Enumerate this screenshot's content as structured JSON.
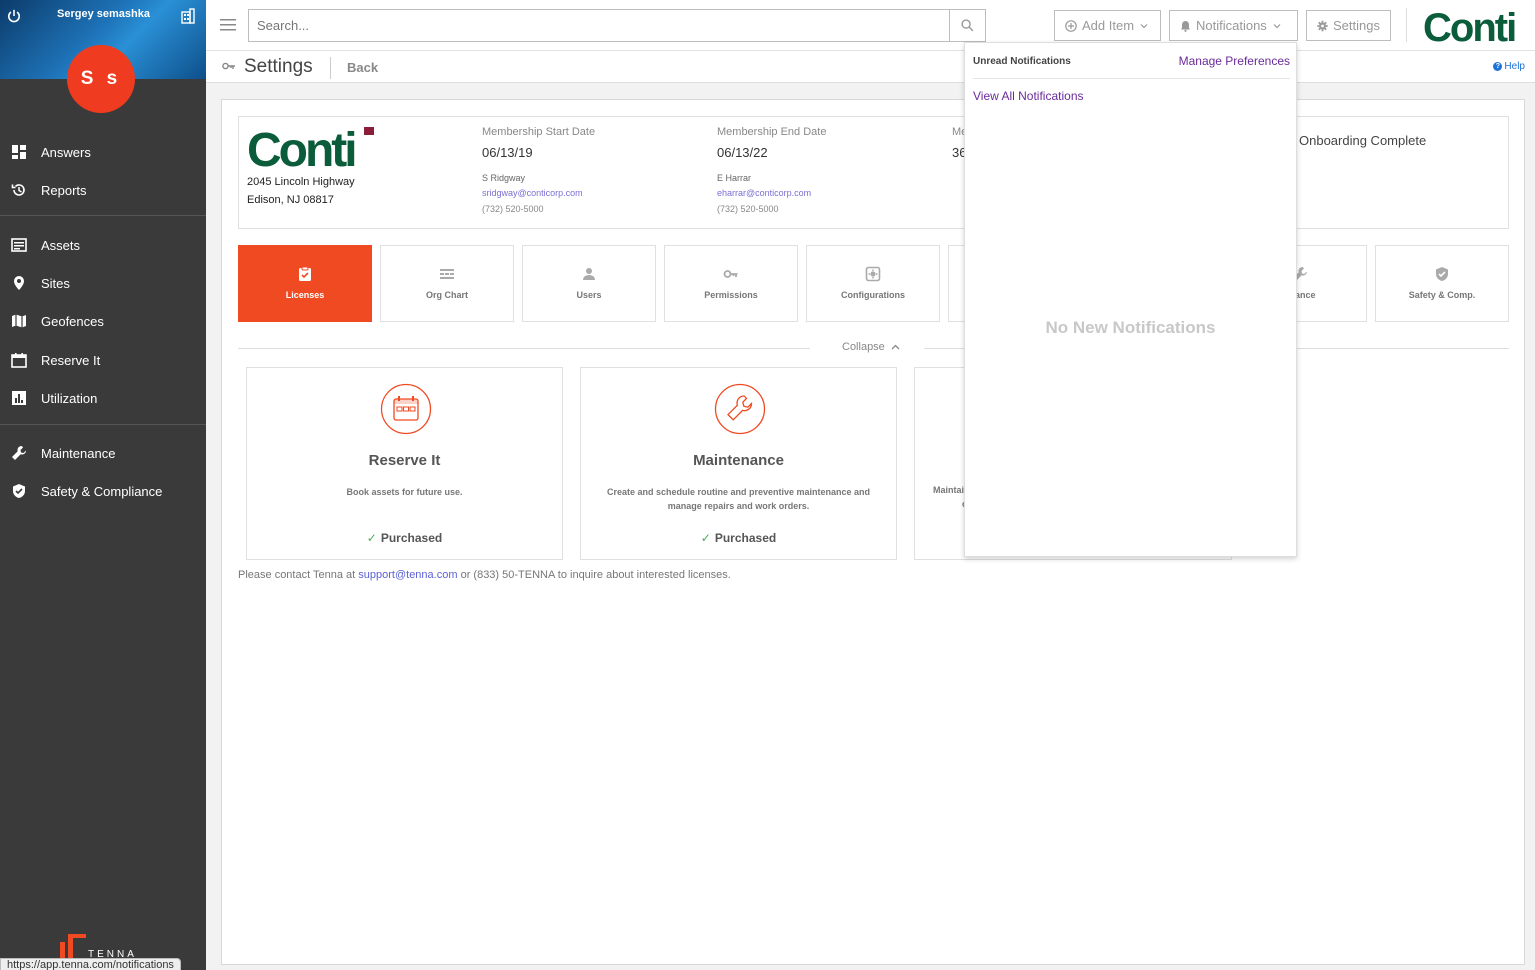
{
  "sidebar": {
    "user_name": "Sergey semashka",
    "avatar_initials": "S s",
    "items": [
      {
        "label": "Answers",
        "icon": "dashboard-icon"
      },
      {
        "label": "Reports",
        "icon": "history-icon"
      },
      {
        "label": "Assets",
        "icon": "list-icon"
      },
      {
        "label": "Sites",
        "icon": "pin-icon"
      },
      {
        "label": "Geofences",
        "icon": "map-icon"
      },
      {
        "label": "Reserve It",
        "icon": "calendar-icon"
      },
      {
        "label": "Utilization",
        "icon": "bar-chart-icon"
      },
      {
        "label": "Maintenance",
        "icon": "wrench-icon"
      },
      {
        "label": "Safety & Compliance",
        "icon": "shield-icon"
      }
    ],
    "brand": "TENNA",
    "status_url": "https://app.tenna.com/notifications"
  },
  "topbar": {
    "search_placeholder": "Search...",
    "add_item": "Add Item",
    "notifications": "Notifications",
    "settings": "Settings",
    "logo": "Conti"
  },
  "subheader": {
    "title": "Settings",
    "back": "Back",
    "help": "Help"
  },
  "company": {
    "logo": "Conti",
    "address_line1": "2045 Lincoln Highway",
    "address_line2": "Edison, NJ 08817",
    "membership": [
      {
        "label": "Membership Start Date",
        "value": "06/13/19",
        "name": "S Ridgway",
        "email": "sridgway@conticorp.com",
        "phone": "(732) 520-5000"
      },
      {
        "label": "Membership End Date",
        "value": "06/13/22",
        "name": "E Harrar",
        "email": "eharrar@conticorp.com",
        "phone": "(732) 520-5000"
      },
      {
        "label": "Me",
        "value": "36"
      }
    ],
    "onboarding": "Onboarding Complete"
  },
  "tiles": [
    {
      "label": "Licenses",
      "icon": "license-check-icon",
      "active": true
    },
    {
      "label": "Org Chart",
      "icon": "org-chart-icon"
    },
    {
      "label": "Users",
      "icon": "user-icon"
    },
    {
      "label": "Permissions",
      "icon": "key-icon"
    },
    {
      "label": "Configurations",
      "icon": "config-icon"
    },
    {
      "label": "enance",
      "icon": "wrench-icon"
    },
    {
      "label": "Safety & Comp.",
      "icon": "shield-icon"
    }
  ],
  "collapse_label": "Collapse",
  "licenses": [
    {
      "title": "Reserve It",
      "desc": "Book assets for future use.",
      "status": "Purchased",
      "icon": "calendar-icon"
    },
    {
      "title": "Maintenance",
      "desc": "Create and schedule routine and preventive maintenance and manage repairs and work orders.",
      "status": "Purchased",
      "icon": "wrench-icon"
    },
    {
      "title": "",
      "desc_partial": "Maintai",
      "desc_partial2": "c"
    }
  ],
  "contact": {
    "prefix": "Please contact Tenna at ",
    "email": "support@tenna.com",
    "suffix": " or (833) 50-TENNA to inquire about interested licenses."
  },
  "notifications_panel": {
    "unread": "Unread Notifications",
    "manage": "Manage Preferences",
    "view_all": "View All Notifications",
    "empty": "No New Notifications"
  },
  "colors": {
    "accent": "#f04a22",
    "sidebar": "#3a3a3a",
    "brand_green": "#0b5c3a",
    "link_purple": "#6a2b9a"
  }
}
